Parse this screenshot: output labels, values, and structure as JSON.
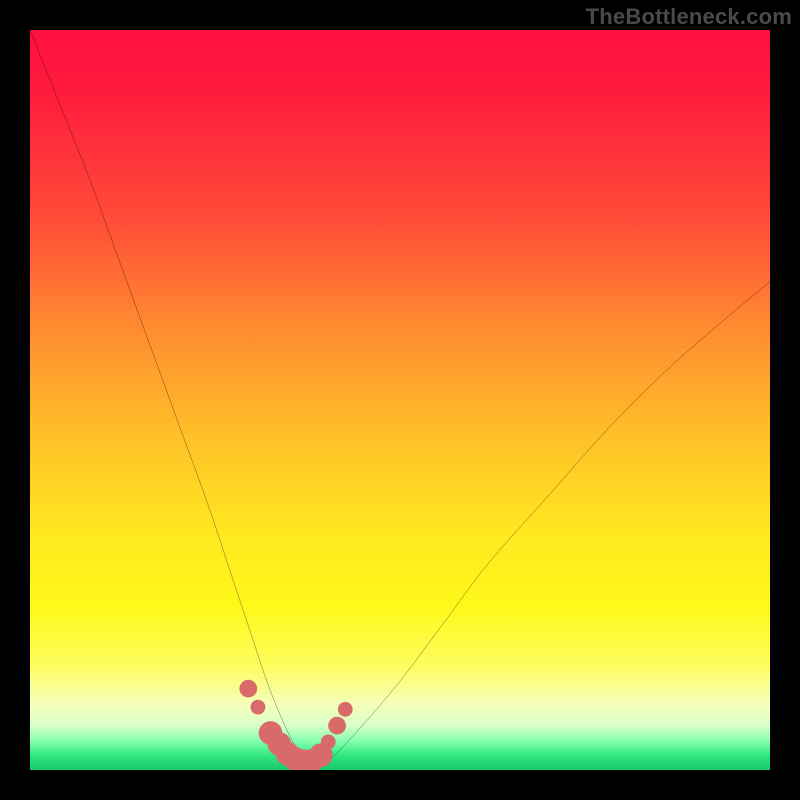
{
  "watermark": {
    "text": "TheBottleneck.com"
  },
  "chart_data": {
    "type": "line",
    "title": "",
    "xlabel": "",
    "ylabel": "",
    "xlim": [
      0,
      100
    ],
    "ylim": [
      0,
      100
    ],
    "grid": false,
    "series": [
      {
        "name": "bottleneck-curve",
        "x": [
          0,
          4,
          8,
          12,
          16,
          20,
          24,
          27,
          30,
          32,
          34,
          36,
          38,
          40,
          44,
          50,
          56,
          62,
          70,
          78,
          86,
          94,
          100
        ],
        "y": [
          100,
          90,
          80,
          69,
          58,
          47,
          36,
          27,
          18,
          12,
          7,
          3,
          1,
          1,
          5,
          12,
          20,
          28,
          37,
          46,
          54,
          61,
          66
        ]
      }
    ],
    "markers": {
      "name": "highlight-dots",
      "color": "#d86a6a",
      "x": [
        29.5,
        30.8,
        32.5,
        33.7,
        34.8,
        35.8,
        36.8,
        38.0,
        39.3,
        40.3,
        41.5,
        42.6
      ],
      "y": [
        11.0,
        8.5,
        5.0,
        3.5,
        2.2,
        1.5,
        1.2,
        1.2,
        2.0,
        3.8,
        6.0,
        8.2
      ],
      "r": [
        1.2,
        1.0,
        1.6,
        1.6,
        1.6,
        1.6,
        1.6,
        1.6,
        1.6,
        1.0,
        1.2,
        1.0
      ]
    }
  }
}
